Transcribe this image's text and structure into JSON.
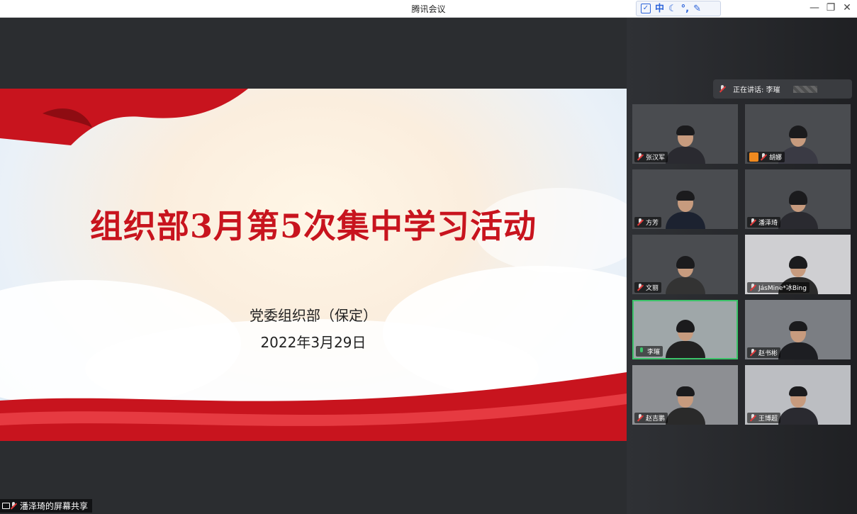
{
  "window": {
    "title": "腾讯会议",
    "minimize_label": "—",
    "restore_label": "❐",
    "close_label": "✕"
  },
  "ime_toolbar": {
    "mode_label": "中",
    "icons": [
      "checkbox-icon",
      "moon-icon",
      "punctuation-icon",
      "wrench-icon"
    ]
  },
  "slide": {
    "title": "组织部3月第5次集中学习活动",
    "organization": "党委组织部（保定）",
    "date": "2022年3月29日"
  },
  "speaking_indicator": {
    "text": "正在讲话: 李璀"
  },
  "participants": [
    {
      "name": "张汉军",
      "mic": "muted"
    },
    {
      "name": "胡娜",
      "mic": "muted",
      "host_badge": true
    },
    {
      "name": "方芳",
      "mic": "muted"
    },
    {
      "name": "潘泽琦",
      "mic": "muted"
    },
    {
      "name": "文丽",
      "mic": "muted"
    },
    {
      "name": "JásMine*冰Bing",
      "mic": "muted"
    },
    {
      "name": "李璀",
      "mic": "on",
      "active": true
    },
    {
      "name": "赵书彬",
      "mic": "muted"
    },
    {
      "name": "赵吉鹏",
      "mic": "muted"
    },
    {
      "name": "王博超",
      "mic": "muted"
    }
  ],
  "screen_share": {
    "label": "潘泽琦的屏幕共享"
  },
  "colors": {
    "title_red": "#c8141e",
    "active_border": "#3cc46a",
    "panel_bg": "#2f3135"
  }
}
